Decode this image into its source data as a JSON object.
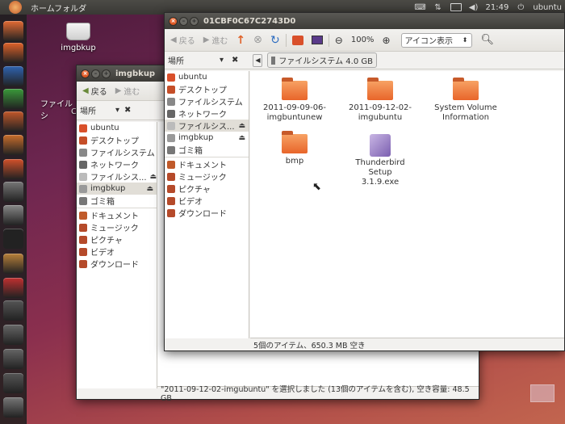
{
  "panel": {
    "title": "ホームフォルダ",
    "time": "21:49",
    "user": "ubuntu"
  },
  "desktop": {
    "drive_label": "imgbkup"
  },
  "launcher": {
    "items": [
      {
        "name": "home-folder-launcher-icon",
        "color": "#e46b34"
      },
      {
        "name": "firefox-launcher-icon",
        "color": "#e0622a"
      },
      {
        "name": "writer-launcher-icon",
        "color": "#2f63b0"
      },
      {
        "name": "calc-launcher-icon",
        "color": "#3a9a3a"
      },
      {
        "name": "impress-launcher-icon",
        "color": "#c2582a"
      },
      {
        "name": "software-center-launcher-icon",
        "color": "#c96d2c"
      },
      {
        "name": "ubuntu-one-launcher-icon",
        "color": "#d2512a"
      },
      {
        "name": "camera-launcher-icon",
        "color": "#777"
      },
      {
        "name": "text-editor-launcher-icon",
        "color": "#888"
      },
      {
        "name": "terminal-launcher-icon",
        "color": "#222"
      },
      {
        "name": "tools-launcher-icon",
        "color": "#b8803a"
      },
      {
        "name": "colors-launcher-icon",
        "color": "#c03030"
      },
      {
        "name": "window-launcher-icon",
        "color": "#555"
      },
      {
        "name": "disc-launcher-icon",
        "color": "#666"
      },
      {
        "name": "disc2-launcher-icon",
        "color": "#666"
      },
      {
        "name": "usb-launcher-icon",
        "color": "#555"
      },
      {
        "name": "drive-launcher-icon",
        "color": "#777"
      }
    ]
  },
  "back_window": {
    "title": "imgbkup",
    "back_label": "戻る",
    "forward_label": "進む",
    "places_label": "場所",
    "status": "\"2011-09-12-02-imgubuntu\" を選択しました (13個のアイテムを含む), 空き容量: 48.5 GB",
    "bg_item": "ファイルシ",
    "bg_item2": "C"
  },
  "front_window": {
    "title": "01CBF0C67C2743D0",
    "back_label": "戻る",
    "forward_label": "進む",
    "zoom": "100%",
    "view_mode": "アイコン表示",
    "places_label": "場所",
    "path_button": "ファイルシステム 4.0 GB",
    "status": "5個のアイテム、650.3 MB 空き"
  },
  "sidebar_items": [
    {
      "label": "ubuntu",
      "color": "#d9502b"
    },
    {
      "label": "デスクトップ",
      "color": "#c54e28"
    },
    {
      "label": "ファイルシステム",
      "color": "#888"
    },
    {
      "label": "ネットワーク",
      "color": "#666"
    },
    {
      "label": "ファイルシス...",
      "color": "#bbb"
    },
    {
      "label": "imgbkup",
      "color": "#999"
    },
    {
      "label": "ゴミ箱",
      "color": "#777"
    },
    {
      "label": "ドキュメント",
      "color": "#c05a2a"
    },
    {
      "label": "ミュージック",
      "color": "#b54a2a"
    },
    {
      "label": "ピクチャ",
      "color": "#b54a2a"
    },
    {
      "label": "ビデオ",
      "color": "#b54a2a"
    },
    {
      "label": "ダウンロード",
      "color": "#b54a2a"
    }
  ],
  "files": [
    {
      "line1": "2011-09-09-06-",
      "line2": "imgbuntunew",
      "type": "folder"
    },
    {
      "line1": "2011-09-12-02-",
      "line2": "imgubuntu",
      "type": "folder"
    },
    {
      "line1": "System Volume",
      "line2": "Information",
      "type": "folder"
    },
    {
      "line1": "bmp",
      "line2": "",
      "type": "folder"
    },
    {
      "line1": "Thunderbird Setup",
      "line2": "3.1.9.exe",
      "type": "exe"
    }
  ]
}
